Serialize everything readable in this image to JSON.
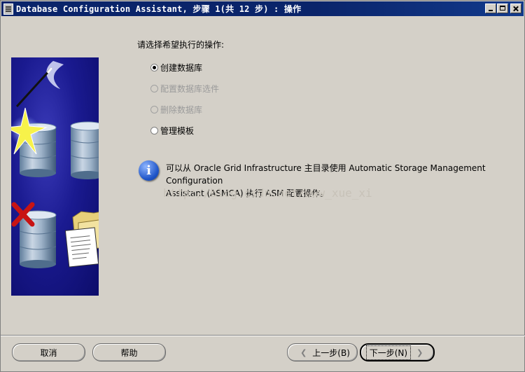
{
  "window": {
    "title": "Database Configuration Assistant, 步骤 1(共 12 步) : 操作"
  },
  "main": {
    "prompt": "请选择希望执行的操作:",
    "options": [
      {
        "label": "创建数据库",
        "selected": true,
        "enabled": true
      },
      {
        "label": "配置数据库选件",
        "selected": false,
        "enabled": false
      },
      {
        "label": "删除数据库",
        "selected": false,
        "enabled": false
      },
      {
        "label": "管理模板",
        "selected": false,
        "enabled": true
      }
    ],
    "info_line1": "可以从 Oracle Grid Infrastructure 主目录使用 Automatic Storage Management Configuration",
    "info_line2": "Assistant (ASMCA) 执行 ASM 配置操作。",
    "watermark": "http://blog.csdn.net/www_xue_xi"
  },
  "buttons": {
    "cancel": "取消",
    "help": "帮助",
    "back": "上一步(B)",
    "next": "下一步(N)"
  },
  "colors": {
    "title_bar": "#0a246a",
    "panel": "#d4d0c8",
    "art_background": "#1a1a90",
    "info_icon": "#1f55c8"
  },
  "icons": [
    "app-icon",
    "minimize-icon",
    "maximize-icon",
    "close-icon",
    "info-icon",
    "magic-wand-icon",
    "database-icon",
    "checkbox-icon",
    "delete-x-icon",
    "folder-icon",
    "document-icon"
  ]
}
